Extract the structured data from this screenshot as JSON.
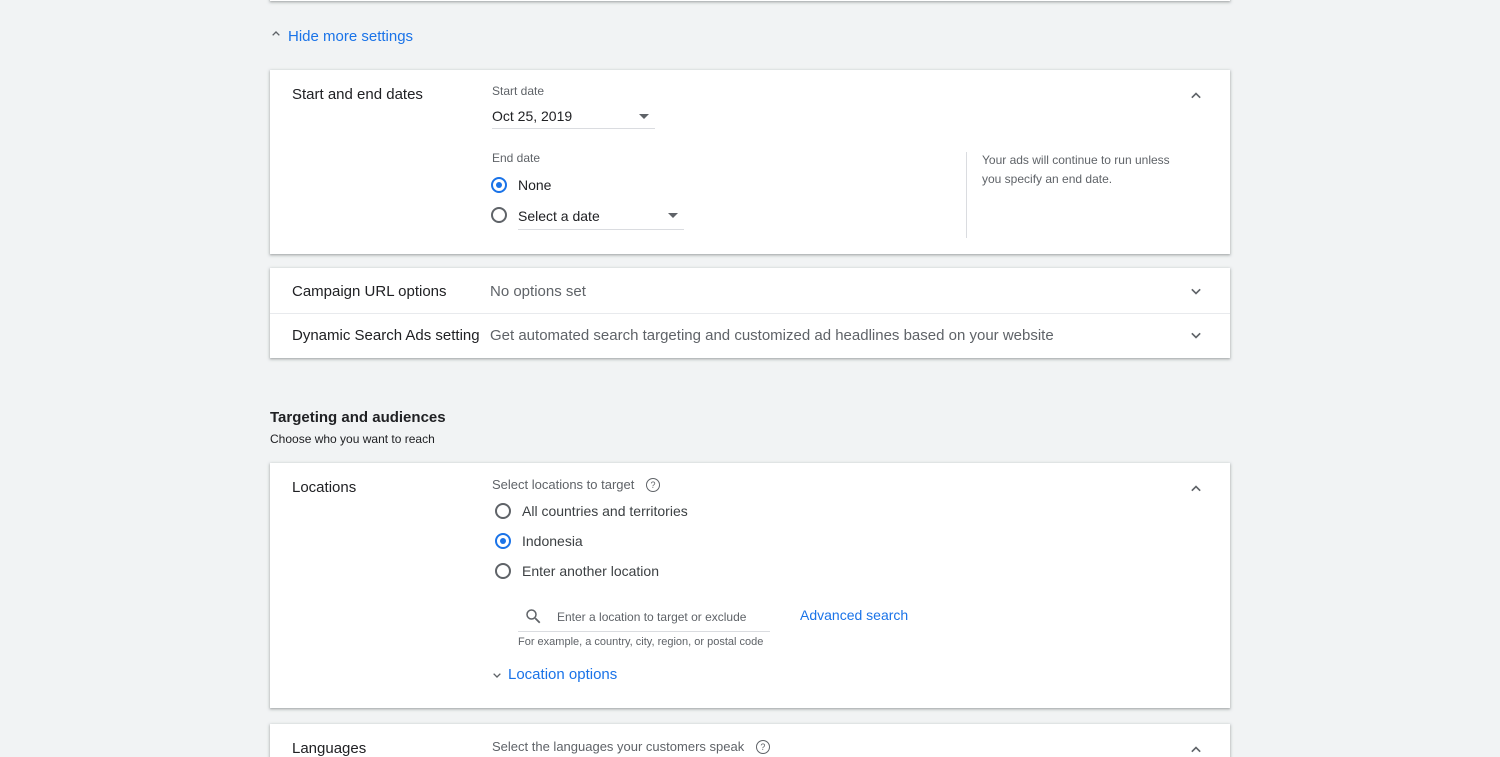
{
  "top_link": {
    "label": "Hide more settings",
    "icon": "chevron-up-icon"
  },
  "dates_section": {
    "label": "Start and end dates",
    "start_caption": "Start date",
    "start_value": "Oct 25, 2019",
    "end_caption": "End date",
    "end_options": [
      {
        "label": "None",
        "selected": true
      },
      {
        "label": "Select a date",
        "selected": false
      }
    ],
    "help_text": "Your ads will continue to run unless you specify an end date."
  },
  "url_options": {
    "label": "Campaign URL options",
    "value": "No options set"
  },
  "dsa_setting": {
    "label": "Dynamic Search Ads setting",
    "value": "Get automated search targeting and customized ad headlines based on your website"
  },
  "targeting": {
    "title": "Targeting and audiences",
    "subtitle": "Choose who you want to reach"
  },
  "locations": {
    "label": "Locations",
    "prompt": "Select locations to target",
    "options": [
      {
        "label": "All countries and territories",
        "selected": false
      },
      {
        "label": "Indonesia",
        "selected": true
      },
      {
        "label": "Enter another location",
        "selected": false
      }
    ],
    "search_placeholder": "Enter a location to target or exclude",
    "search_hint": "For example, a country, city, region, or postal code",
    "advanced_search": "Advanced search",
    "location_options": "Location options"
  },
  "languages": {
    "label": "Languages",
    "prompt": "Select the languages your customers speak"
  },
  "colors": {
    "accent": "#1a73e8",
    "text": "#202124",
    "muted": "#5f6368",
    "background": "#f1f3f4"
  }
}
